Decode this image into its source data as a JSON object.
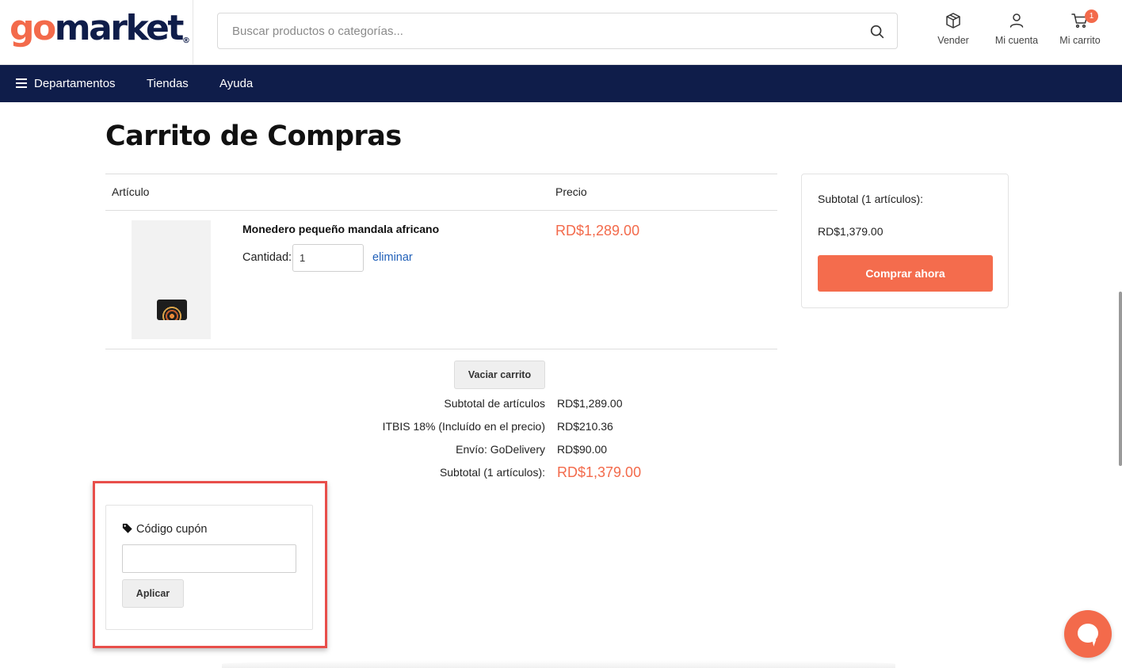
{
  "brand": {
    "logo_go": "go",
    "logo_market": "market",
    "logo_reg": "®",
    "accent": "#f36a4b",
    "navy": "#0f1d4a"
  },
  "search": {
    "placeholder": "Buscar productos o categorías...",
    "icon": "search-icon"
  },
  "header_actions": [
    {
      "label": "Vender",
      "icon": "box-icon"
    },
    {
      "label": "Mi cuenta",
      "icon": "user-icon"
    },
    {
      "label": "Mi carrito",
      "icon": "cart-icon",
      "badge": "1"
    }
  ],
  "nav": {
    "departments": "Departamentos",
    "stores": "Tiendas",
    "help": "Ayuda"
  },
  "page": {
    "title": "Carrito de Compras"
  },
  "table": {
    "col_article": "Artículo",
    "col_price": "Precio"
  },
  "item": {
    "name": "Monedero pequeño mandala africano",
    "qty_label": "Cantidad:",
    "qty_value": "1",
    "remove": "eliminar",
    "price": "RD$1,289.00"
  },
  "actions": {
    "empty_cart": "Vaciar carrito"
  },
  "summary": {
    "rows": [
      {
        "label": "Subtotal de artículos",
        "value": "RD$1,289.00"
      },
      {
        "label": "ITBIS 18% (Incluído en el precio)",
        "value": "RD$210.36"
      },
      {
        "label": "Envío: GoDelivery",
        "value": "RD$90.00"
      },
      {
        "label": "Subtotal (1 artículos):",
        "value": "RD$1,379.00"
      }
    ]
  },
  "card": {
    "subtotal_label": "Subtotal (1 artículos):",
    "total": "RD$1,379.00",
    "buy_button": "Comprar ahora"
  },
  "coupon": {
    "title": "Código cupón",
    "input_value": "",
    "apply_button": "Aplicar"
  }
}
